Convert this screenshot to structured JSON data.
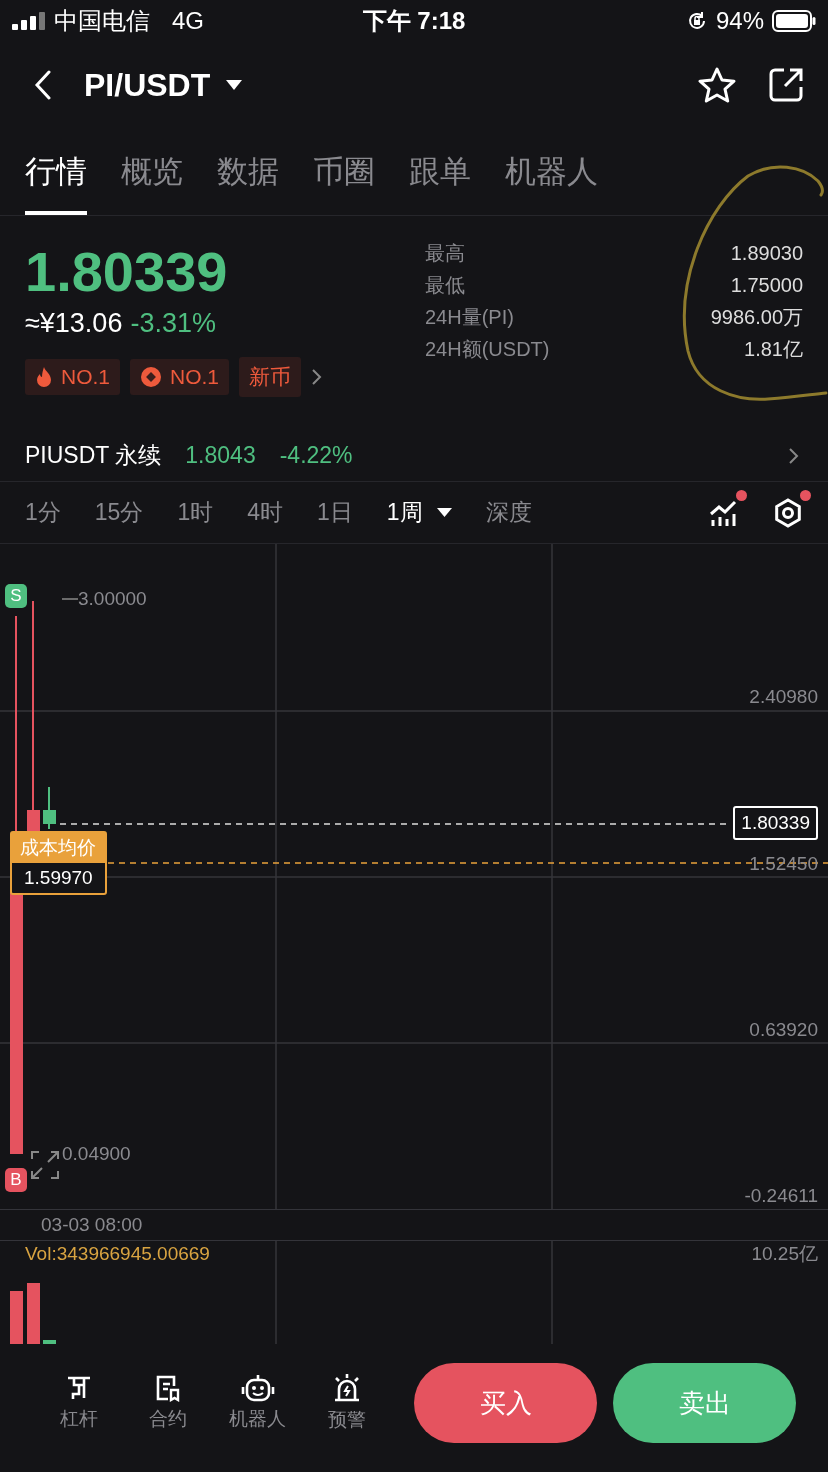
{
  "status_bar": {
    "carrier": "中国电信",
    "network": "4G",
    "time": "下午 7:18",
    "battery": "94%"
  },
  "header": {
    "pair": "PI/USDT"
  },
  "tabs": [
    {
      "label": "行情",
      "selected": true
    },
    {
      "label": "概览",
      "selected": false
    },
    {
      "label": "数据",
      "selected": false
    },
    {
      "label": "币圈",
      "selected": false
    },
    {
      "label": "跟单",
      "selected": false
    },
    {
      "label": "机器人",
      "selected": false
    }
  ],
  "ticker": {
    "price": "1.80339",
    "cny": "≈¥13.06",
    "change": "-3.31%",
    "badges": [
      {
        "kind": "hot",
        "label": "NO.1"
      },
      {
        "kind": "coin",
        "label": "NO.1"
      },
      {
        "kind": "plain",
        "label": "新币"
      }
    ],
    "stats": [
      {
        "label": "最高",
        "value": "1.89030"
      },
      {
        "label": "最低",
        "value": "1.75000"
      },
      {
        "label": "24H量(PI)",
        "value": "9986.00万"
      },
      {
        "label": "24H额(USDT)",
        "value": "1.81亿"
      }
    ]
  },
  "perpetual": {
    "name": "PIUSDT 永续",
    "price": "1.8043",
    "change": "-4.22%"
  },
  "intervals": [
    {
      "label": "1分",
      "kind": "interval",
      "selected": false
    },
    {
      "label": "15分",
      "kind": "interval",
      "selected": false
    },
    {
      "label": "1时",
      "kind": "interval",
      "selected": false
    },
    {
      "label": "4时",
      "kind": "interval",
      "selected": false
    },
    {
      "label": "1日",
      "kind": "interval",
      "selected": false
    },
    {
      "label": "1周",
      "kind": "menu",
      "selected": true
    },
    {
      "label": "深度",
      "kind": "interval",
      "selected": false
    }
  ],
  "chart_tools": [
    {
      "kind": "indicators",
      "dot": true
    },
    {
      "kind": "settings",
      "dot": true
    }
  ],
  "chart": {
    "sell_marker": "S",
    "high_price": "3.00000",
    "axis_labels": [
      "2.40980",
      "0.63920",
      "-0.24611"
    ],
    "last_price": "1.80339",
    "line_price": "1.52450",
    "avg_cost_label": "成本均价",
    "avg_cost": "1.59970",
    "low_price": "0.04900",
    "buy_marker": "B",
    "date": "03-03 08:00"
  },
  "volume": {
    "label": "Vol:343966945.00669",
    "axis_label": "10.25亿"
  },
  "bottom_tools": [
    {
      "kind": "leverage",
      "label": "杠杆"
    },
    {
      "kind": "contract",
      "label": "合约"
    },
    {
      "kind": "robot",
      "label": "机器人"
    },
    {
      "kind": "alert",
      "label": "预警"
    }
  ],
  "buy_button": "买入",
  "sell_button": "卖出"
}
